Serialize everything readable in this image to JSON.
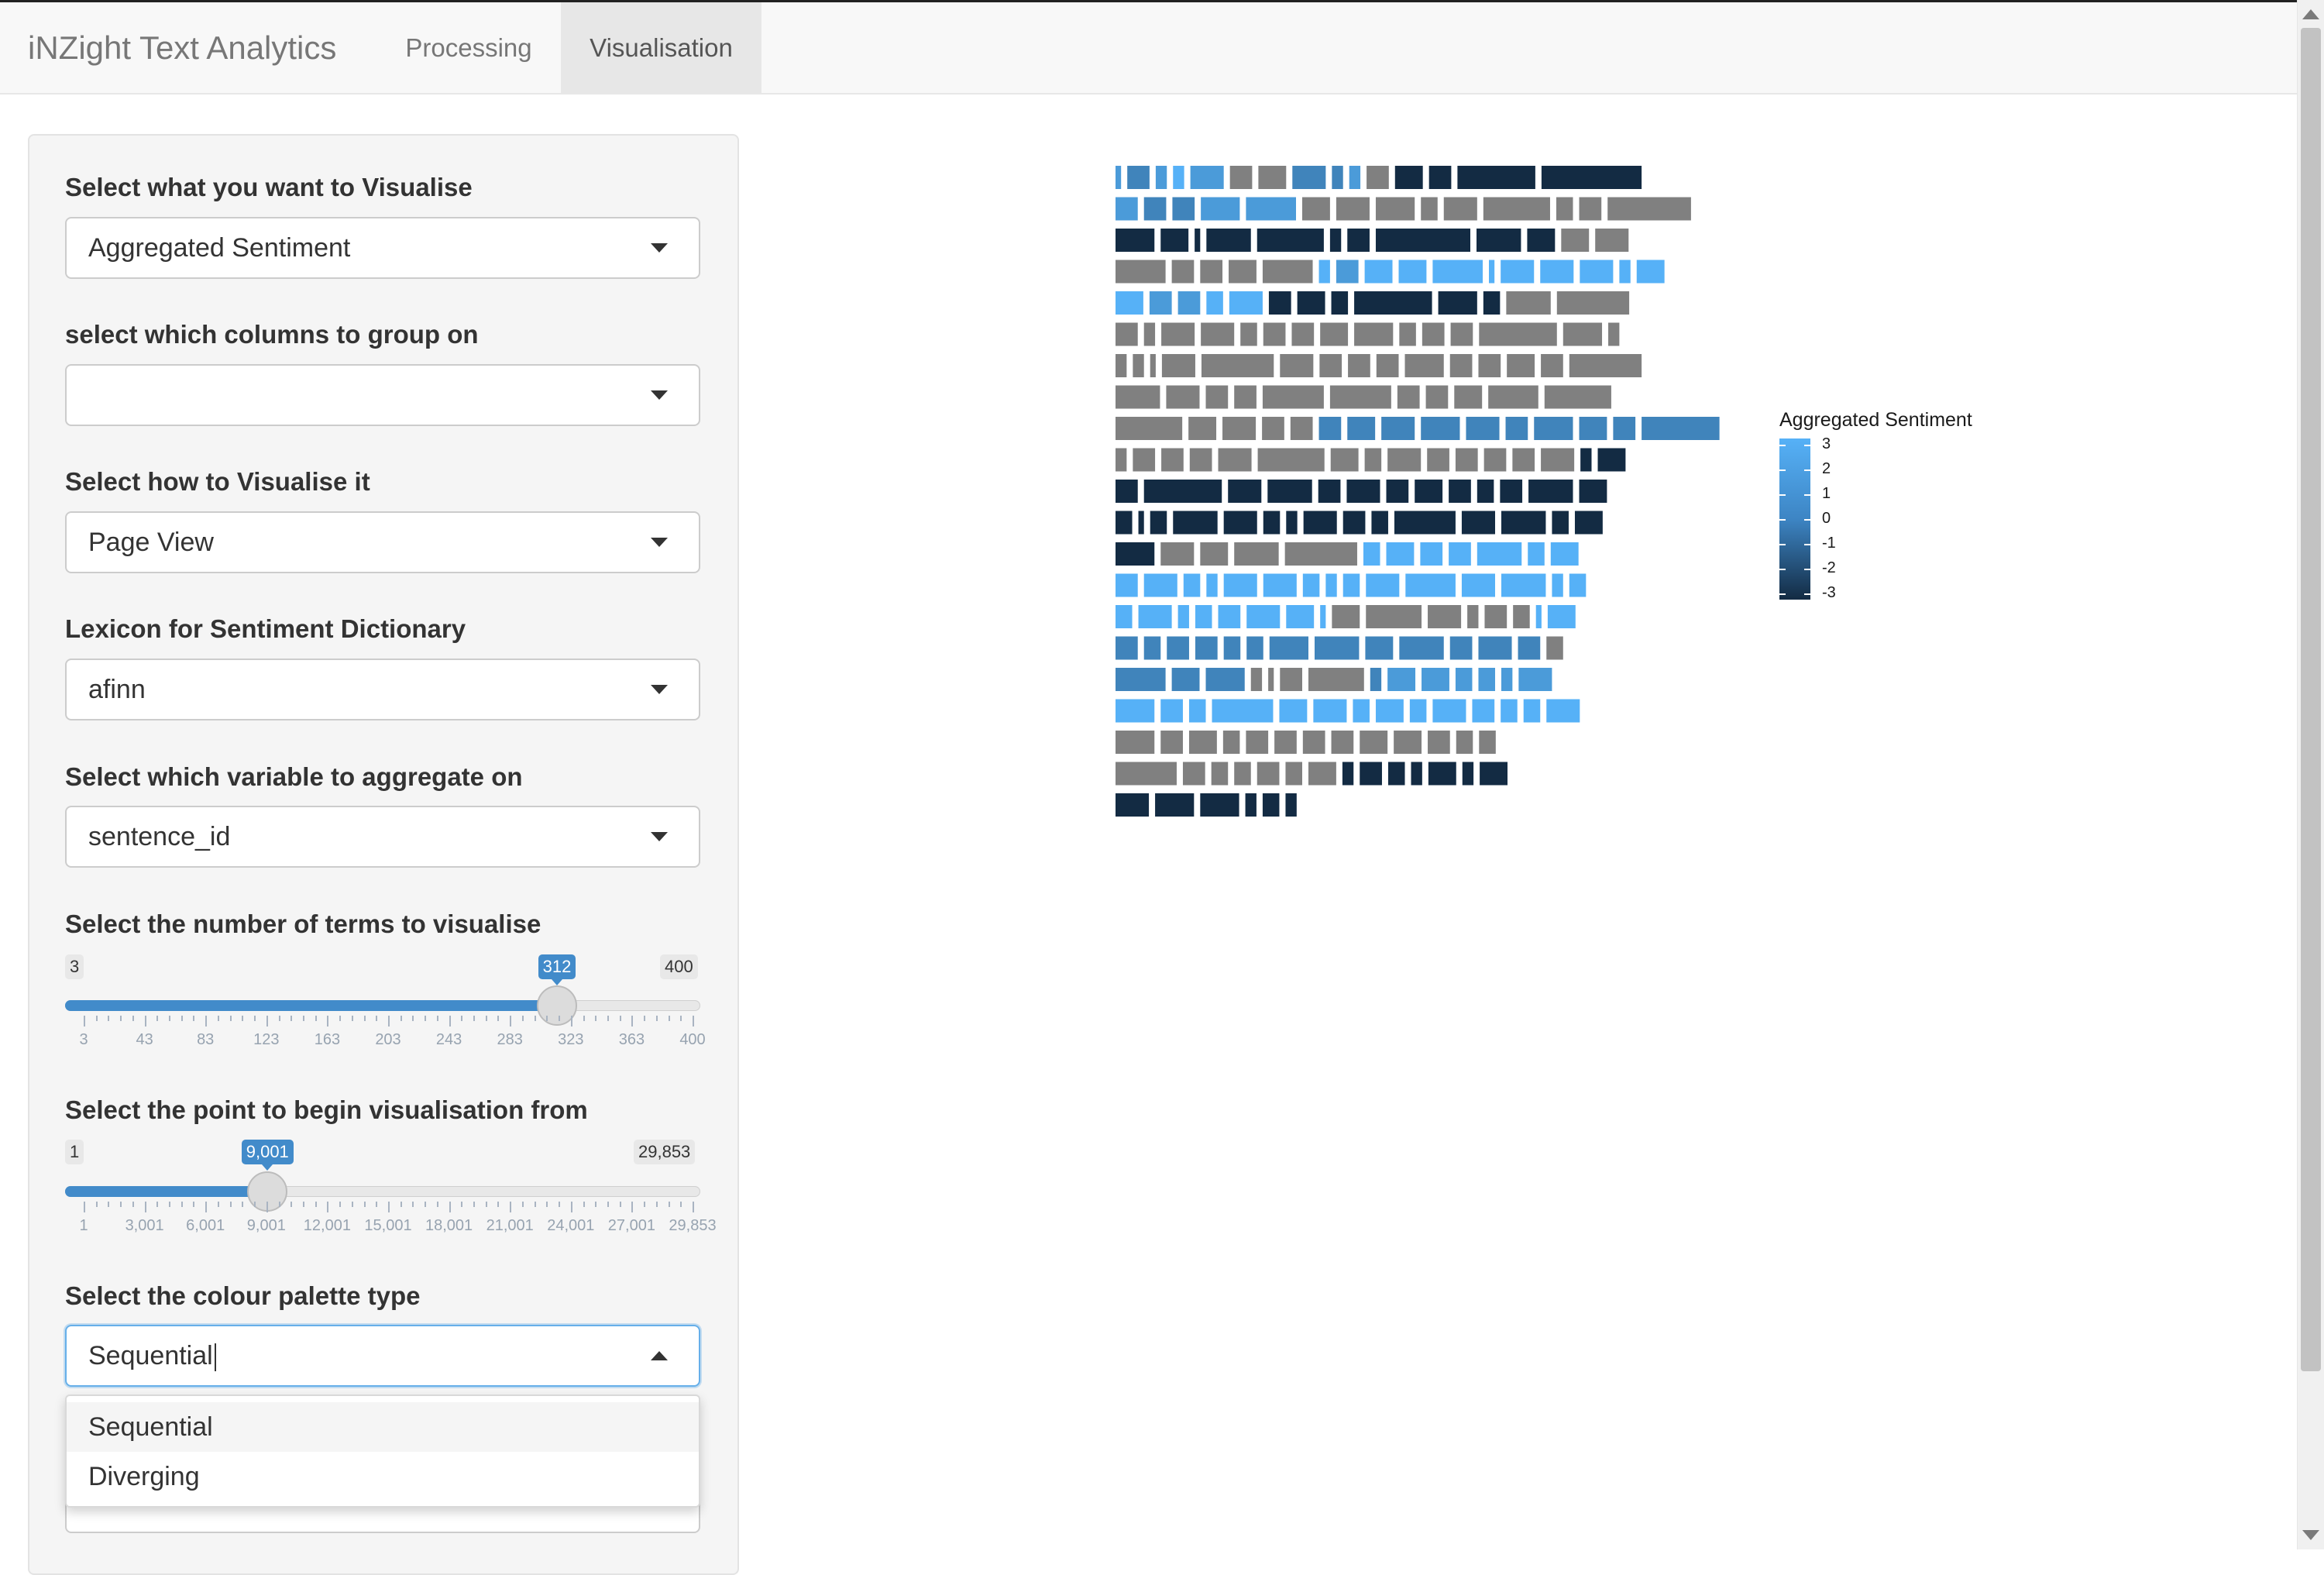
{
  "navbar": {
    "brand": "iNZight Text Analytics",
    "tabs": [
      {
        "label": "Processing",
        "active": false
      },
      {
        "label": "Visualisation",
        "active": true
      }
    ]
  },
  "sidebar": {
    "visualise_what": {
      "label": "Select what you want to Visualise",
      "value": "Aggregated Sentiment"
    },
    "group_columns": {
      "label": "select which columns to group on",
      "value": ""
    },
    "visualise_how": {
      "label": "Select how to Visualise it",
      "value": "Page View"
    },
    "lexicon": {
      "label": "Lexicon for Sentiment Dictionary",
      "value": "afinn"
    },
    "aggregate_variable": {
      "label": "Select which variable to aggregate on",
      "value": "sentence_id"
    },
    "num_terms_slider": {
      "label": "Select the number of terms to visualise",
      "min_label": "3",
      "max_label": "400",
      "value_label": "312",
      "value_fraction": 0.7809,
      "ticks": [
        "3",
        "43",
        "83",
        "123",
        "163",
        "203",
        "243",
        "283",
        "323",
        "363",
        "400"
      ]
    },
    "start_point_slider": {
      "label": "Select the point to begin visualisation from",
      "min_label": "1",
      "max_label": "29,853",
      "value_label": "9,001",
      "value_fraction": 0.3016,
      "ticks": [
        "1",
        "3,001",
        "6,001",
        "9,001",
        "12,001",
        "15,001",
        "18,001",
        "21,001",
        "24,001",
        "27,001",
        "29,853"
      ]
    },
    "palette_type": {
      "label": "Select the colour palette type",
      "value": "Sequential",
      "open": true,
      "options": [
        "Sequential",
        "Diverging"
      ]
    }
  },
  "chart_data": {
    "type": "heatmap",
    "description_free": true,
    "legend_title": "Aggregated Sentiment",
    "legend_ticks": [
      "3",
      "2",
      "1",
      "0",
      "-1",
      "-2",
      "-3"
    ],
    "colors": {
      "high": "#56b1f7",
      "low": "#132b43",
      "neutral": "#808080"
    },
    "rows": [
      [
        [
          1,
          2
        ],
        [
          4,
          1
        ],
        [
          2,
          2
        ],
        [
          2,
          3
        ],
        [
          6,
          2
        ],
        [
          4,
          0
        ],
        [
          5,
          0
        ],
        [
          6,
          1
        ],
        [
          2,
          1
        ],
        [
          2,
          2
        ],
        [
          4,
          0
        ],
        [
          5,
          -3
        ],
        [
          4,
          -3
        ],
        [
          14,
          -3
        ],
        [
          18,
          -3
        ]
      ],
      [
        [
          4,
          2
        ],
        [
          4,
          1
        ],
        [
          4,
          1
        ],
        [
          7,
          2
        ],
        [
          9,
          2
        ],
        [
          5,
          0
        ],
        [
          6,
          0
        ],
        [
          7,
          0
        ],
        [
          3,
          0
        ],
        [
          6,
          0
        ],
        [
          12,
          0
        ],
        [
          3,
          0
        ],
        [
          4,
          0
        ],
        [
          15,
          0
        ]
      ],
      [
        [
          7,
          -3
        ],
        [
          5,
          -3
        ],
        [
          1,
          -3
        ],
        [
          8,
          -3
        ],
        [
          12,
          -3
        ],
        [
          2,
          -3
        ],
        [
          4,
          -3
        ],
        [
          17,
          -3
        ],
        [
          8,
          -3
        ],
        [
          5,
          -3
        ],
        [
          5,
          0
        ],
        [
          6,
          0
        ]
      ],
      [
        [
          9,
          0
        ],
        [
          4,
          0
        ],
        [
          4,
          0
        ],
        [
          5,
          0
        ],
        [
          9,
          0
        ],
        [
          2,
          3
        ],
        [
          4,
          2
        ],
        [
          5,
          3
        ],
        [
          5,
          3
        ],
        [
          9,
          3
        ],
        [
          1,
          3
        ],
        [
          6,
          3
        ],
        [
          6,
          3
        ],
        [
          6,
          3
        ],
        [
          2,
          3
        ],
        [
          5,
          3
        ]
      ],
      [
        [
          5,
          3
        ],
        [
          4,
          2
        ],
        [
          4,
          2
        ],
        [
          3,
          3
        ],
        [
          6,
          3
        ],
        [
          4,
          -3
        ],
        [
          5,
          -3
        ],
        [
          3,
          -3
        ],
        [
          14,
          -3
        ],
        [
          7,
          -3
        ],
        [
          3,
          -3
        ],
        [
          8,
          0
        ],
        [
          13,
          0
        ]
      ],
      [
        [
          4,
          0
        ],
        [
          2,
          0
        ],
        [
          6,
          0
        ],
        [
          6,
          0
        ],
        [
          3,
          0
        ],
        [
          4,
          0
        ],
        [
          4,
          0
        ],
        [
          5,
          0
        ],
        [
          7,
          0
        ],
        [
          3,
          0
        ],
        [
          4,
          0
        ],
        [
          4,
          0
        ],
        [
          14,
          0
        ],
        [
          7,
          0
        ],
        [
          2,
          0
        ]
      ],
      [
        [
          2,
          0
        ],
        [
          2,
          0
        ],
        [
          1,
          0
        ],
        [
          6,
          0
        ],
        [
          13,
          0
        ],
        [
          6,
          0
        ],
        [
          4,
          0
        ],
        [
          4,
          0
        ],
        [
          4,
          0
        ],
        [
          7,
          0
        ],
        [
          4,
          0
        ],
        [
          4,
          0
        ],
        [
          5,
          0
        ],
        [
          4,
          0
        ],
        [
          13,
          0
        ]
      ],
      [
        [
          8,
          0
        ],
        [
          6,
          0
        ],
        [
          4,
          0
        ],
        [
          4,
          0
        ],
        [
          11,
          0
        ],
        [
          11,
          0
        ],
        [
          4,
          0
        ],
        [
          4,
          0
        ],
        [
          5,
          0
        ],
        [
          9,
          0
        ],
        [
          12,
          0
        ]
      ],
      [
        [
          12,
          0
        ],
        [
          5,
          0
        ],
        [
          6,
          0
        ],
        [
          4,
          0
        ],
        [
          4,
          0
        ],
        [
          4,
          1
        ],
        [
          5,
          1
        ],
        [
          6,
          1
        ],
        [
          7,
          1
        ],
        [
          6,
          1
        ],
        [
          4,
          1
        ],
        [
          7,
          1
        ],
        [
          5,
          1
        ],
        [
          4,
          1
        ],
        [
          14,
          1
        ]
      ],
      [
        [
          2,
          0
        ],
        [
          4,
          0
        ],
        [
          4,
          0
        ],
        [
          4,
          0
        ],
        [
          6,
          0
        ],
        [
          12,
          0
        ],
        [
          5,
          0
        ],
        [
          3,
          0
        ],
        [
          6,
          0
        ],
        [
          4,
          0
        ],
        [
          4,
          0
        ],
        [
          4,
          0
        ],
        [
          4,
          0
        ],
        [
          6,
          0
        ],
        [
          2,
          -3
        ],
        [
          5,
          -3
        ]
      ],
      [
        [
          4,
          -3
        ],
        [
          14,
          -3
        ],
        [
          6,
          -3
        ],
        [
          8,
          -3
        ],
        [
          4,
          -3
        ],
        [
          6,
          -3
        ],
        [
          4,
          -3
        ],
        [
          5,
          -3
        ],
        [
          4,
          -3
        ],
        [
          3,
          -3
        ],
        [
          4,
          -3
        ],
        [
          8,
          -3
        ],
        [
          5,
          -3
        ]
      ],
      [
        [
          3,
          -3
        ],
        [
          1,
          -3
        ],
        [
          3,
          -3
        ],
        [
          8,
          -3
        ],
        [
          6,
          -3
        ],
        [
          3,
          -3
        ],
        [
          2,
          -3
        ],
        [
          6,
          -3
        ],
        [
          4,
          -3
        ],
        [
          3,
          -3
        ],
        [
          11,
          -3
        ],
        [
          6,
          -3
        ],
        [
          8,
          -3
        ],
        [
          3,
          -3
        ],
        [
          5,
          -3
        ]
      ],
      [
        [
          7,
          -3
        ],
        [
          6,
          0
        ],
        [
          5,
          0
        ],
        [
          8,
          0
        ],
        [
          13,
          0
        ],
        [
          3,
          3
        ],
        [
          5,
          3
        ],
        [
          4,
          3
        ],
        [
          4,
          3
        ],
        [
          8,
          3
        ],
        [
          3,
          3
        ],
        [
          5,
          3
        ]
      ],
      [
        [
          4,
          3
        ],
        [
          6,
          3
        ],
        [
          3,
          3
        ],
        [
          2,
          3
        ],
        [
          6,
          3
        ],
        [
          6,
          3
        ],
        [
          3,
          3
        ],
        [
          2,
          3
        ],
        [
          3,
          3
        ],
        [
          6,
          3
        ],
        [
          9,
          3
        ],
        [
          6,
          3
        ],
        [
          8,
          3
        ],
        [
          2,
          3
        ],
        [
          3,
          3
        ]
      ],
      [
        [
          3,
          3
        ],
        [
          6,
          3
        ],
        [
          2,
          3
        ],
        [
          3,
          3
        ],
        [
          4,
          3
        ],
        [
          6,
          3
        ],
        [
          5,
          3
        ],
        [
          1,
          3
        ],
        [
          5,
          0
        ],
        [
          10,
          0
        ],
        [
          6,
          0
        ],
        [
          2,
          0
        ],
        [
          4,
          0
        ],
        [
          3,
          0
        ],
        [
          1,
          3
        ],
        [
          5,
          3
        ]
      ],
      [
        [
          4,
          1
        ],
        [
          3,
          1
        ],
        [
          4,
          1
        ],
        [
          4,
          1
        ],
        [
          3,
          1
        ],
        [
          3,
          1
        ],
        [
          7,
          1
        ],
        [
          8,
          1
        ],
        [
          5,
          1
        ],
        [
          8,
          1
        ],
        [
          4,
          1
        ],
        [
          6,
          1
        ],
        [
          4,
          1
        ],
        [
          3,
          0
        ]
      ],
      [
        [
          9,
          1
        ],
        [
          5,
          1
        ],
        [
          7,
          1
        ],
        [
          2,
          0
        ],
        [
          1,
          0
        ],
        [
          4,
          0
        ],
        [
          10,
          0
        ],
        [
          2,
          1
        ],
        [
          5,
          2
        ],
        [
          5,
          2
        ],
        [
          3,
          2
        ],
        [
          3,
          2
        ],
        [
          2,
          2
        ],
        [
          6,
          2
        ]
      ],
      [
        [
          7,
          3
        ],
        [
          4,
          3
        ],
        [
          3,
          3
        ],
        [
          11,
          3
        ],
        [
          5,
          3
        ],
        [
          6,
          3
        ],
        [
          3,
          3
        ],
        [
          5,
          3
        ],
        [
          3,
          3
        ],
        [
          6,
          3
        ],
        [
          4,
          3
        ],
        [
          3,
          3
        ],
        [
          3,
          3
        ],
        [
          6,
          3
        ]
      ],
      [
        [
          7,
          0
        ],
        [
          4,
          0
        ],
        [
          5,
          0
        ],
        [
          3,
          0
        ],
        [
          4,
          0
        ],
        [
          4,
          0
        ],
        [
          4,
          0
        ],
        [
          4,
          0
        ],
        [
          5,
          0
        ],
        [
          5,
          0
        ],
        [
          4,
          0
        ],
        [
          3,
          0
        ],
        [
          3,
          0
        ]
      ],
      [
        [
          11,
          0
        ],
        [
          4,
          0
        ],
        [
          3,
          0
        ],
        [
          3,
          0
        ],
        [
          4,
          0
        ],
        [
          3,
          0
        ],
        [
          5,
          0
        ],
        [
          2,
          -3
        ],
        [
          4,
          -3
        ],
        [
          3,
          -3
        ],
        [
          2,
          -3
        ],
        [
          5,
          -3
        ],
        [
          2,
          -3
        ],
        [
          5,
          -3
        ]
      ],
      [
        [
          6,
          -3
        ],
        [
          7,
          -3
        ],
        [
          7,
          -3
        ],
        [
          2,
          -3
        ],
        [
          3,
          -3
        ],
        [
          2,
          -3
        ]
      ]
    ]
  }
}
